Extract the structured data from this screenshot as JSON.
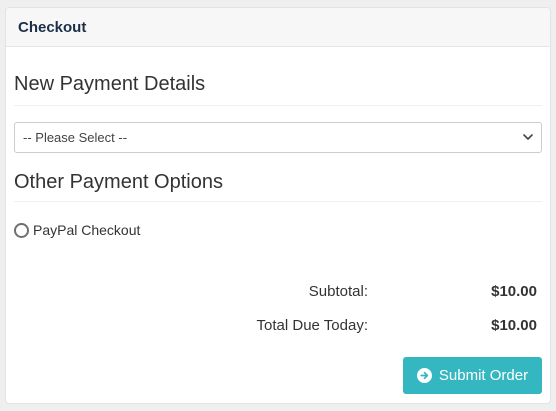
{
  "panel": {
    "title": "Checkout"
  },
  "payment": {
    "heading": "New Payment Details",
    "select_value": "-- Please Select --"
  },
  "other_options": {
    "heading": "Other Payment Options",
    "options": [
      {
        "label": "PayPal Checkout",
        "selected": false
      }
    ]
  },
  "totals": {
    "subtotal_label": "Subtotal:",
    "subtotal_value": "$10.00",
    "total_label": "Total Due Today:",
    "total_value": "$10.00"
  },
  "actions": {
    "submit_label": "Submit Order",
    "submit_icon": "arrow-circle-right-icon"
  },
  "colors": {
    "accent": "#35b7c1",
    "title": "#1b2f48"
  }
}
